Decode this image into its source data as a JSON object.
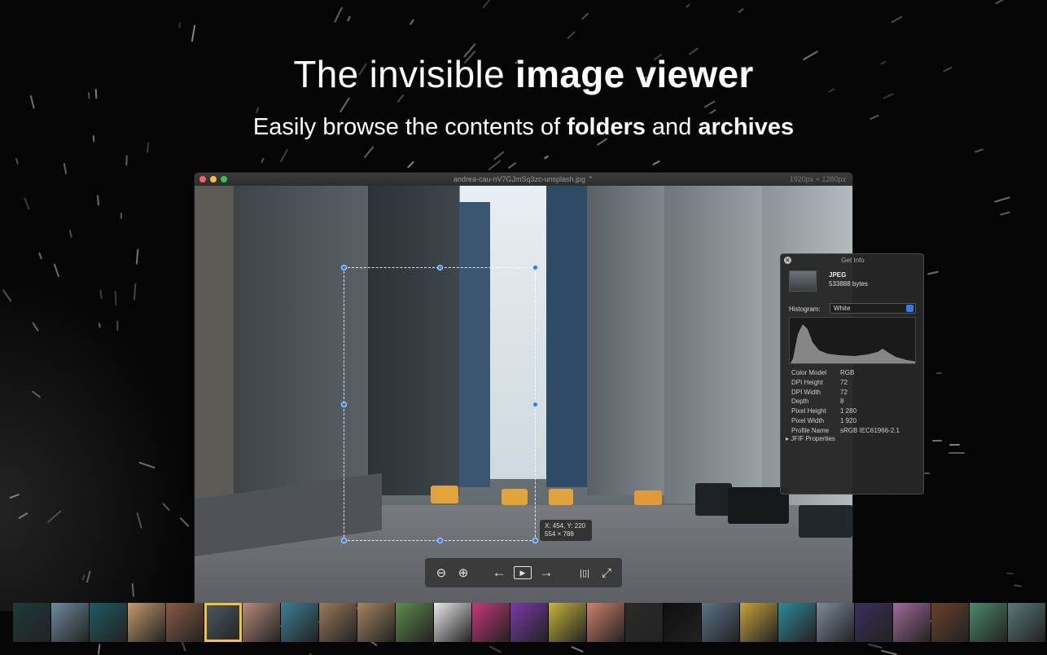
{
  "hero": {
    "title_plain": "The invisible ",
    "title_bold": "image viewer",
    "sub_pre": "Easily browse the contents of ",
    "sub_bold1": "folders",
    "sub_mid": " and ",
    "sub_bold2": "archives"
  },
  "window": {
    "title": "andrea-cau-nV7GJmSq3zc-unsplash.jpg",
    "title_chevron": "⌃",
    "dimensions": "1920px × 1280px"
  },
  "selection": {
    "coords": "X: 454, Y: 220",
    "size": "554 × 788"
  },
  "toolbar": {
    "zoom_out": "⊖",
    "zoom_in": "⊕",
    "prev": "←",
    "play": "▶",
    "next": "→",
    "filmstrip": "|▯|",
    "fullscreen": "⤢"
  },
  "info": {
    "title": "Get Info",
    "close": "×",
    "file_type": "JPEG",
    "file_size": "533888 bytes",
    "histogram_label": "Histogram:",
    "histogram_value": "White",
    "properties": [
      {
        "key": "Color Model",
        "value": "RGB"
      },
      {
        "key": "DPI Height",
        "value": "72"
      },
      {
        "key": "DPI Width",
        "value": "72"
      },
      {
        "key": "Depth",
        "value": "8"
      },
      {
        "key": "Pixel Height",
        "value": "1 280"
      },
      {
        "key": "Pixel Width",
        "value": "1 920"
      },
      {
        "key": "Profile Name",
        "value": "sRGB IEC61966-2.1"
      }
    ],
    "jfif": "JFIF Properties"
  },
  "filmstrip": {
    "selected_index": 5,
    "thumbs": [
      "#1b3b3a",
      "#6f8aa0",
      "#1e5a66",
      "#c49a6a",
      "#8b5a44",
      "#4d5b63",
      "#b88a7a",
      "#3c7f95",
      "#9a7b5a",
      "#a58460",
      "#5f8c4c",
      "#e8e8e8",
      "#c63a7a",
      "#7a3aa8",
      "#c8b43c",
      "#d0806a",
      "#2a2a2a",
      "#0e0e0e",
      "#5b7388",
      "#c9a23a",
      "#2c8a9a",
      "#7c8c9c",
      "#3a2f5a",
      "#a06a9a",
      "#6a3f2a",
      "#4a8a6a",
      "#587878"
    ]
  },
  "colors": {
    "accent": "#2f7bf5",
    "thumb_selected": "#f3c33c"
  }
}
